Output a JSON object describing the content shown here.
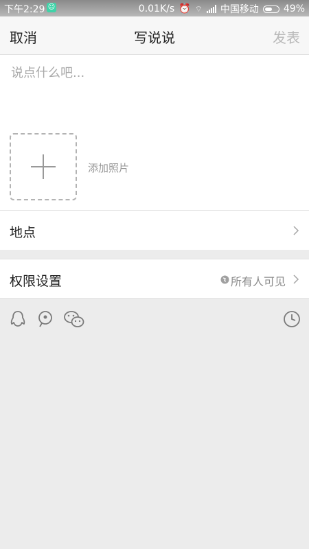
{
  "status_bar": {
    "time": "下午2:29",
    "network_speed": "0.01K/s",
    "carrier": "中国移动",
    "battery": "49%"
  },
  "nav": {
    "cancel_label": "取消",
    "title": "写说说",
    "publish_label": "发表"
  },
  "compose": {
    "placeholder": "说点什么吧...",
    "value": "",
    "add_photo_label": "添加照片"
  },
  "location": {
    "label": "地点"
  },
  "permission": {
    "label": "权限设置",
    "value": "所有人可见"
  },
  "toolbar": {
    "icons": [
      "qq-icon",
      "location-pin-icon",
      "wechat-icon",
      "clock-icon"
    ]
  },
  "colors": {
    "background": "#ececec",
    "disabled_text": "#b9b9b9",
    "placeholder": "#a9a9a9"
  }
}
